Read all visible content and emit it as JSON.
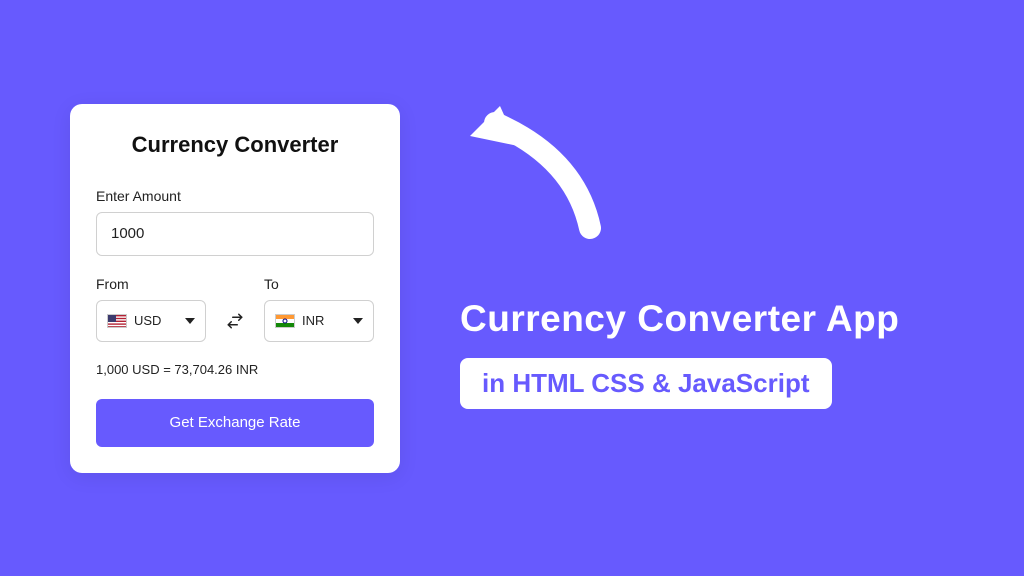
{
  "card": {
    "title": "Currency Converter",
    "amount_label": "Enter Amount",
    "amount_value": "1000",
    "from_label": "From",
    "to_label": "To",
    "from_currency": "USD",
    "to_currency": "INR",
    "result_text": "1,000 USD = 73,704.26 INR",
    "button_label": "Get Exchange Rate"
  },
  "promo": {
    "headline": "Currency Converter App",
    "pill_text": "in HTML CSS & JavaScript"
  }
}
